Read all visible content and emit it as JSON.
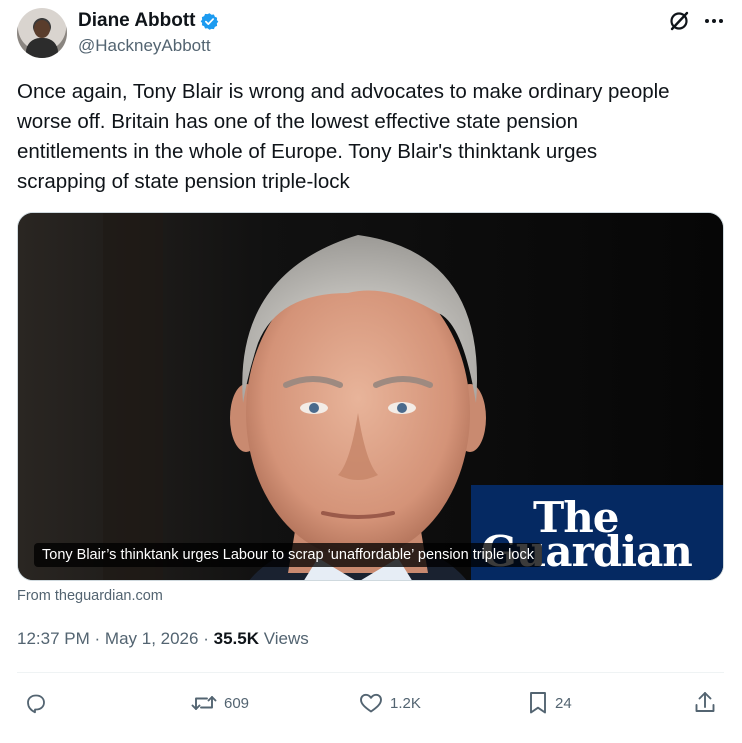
{
  "author": {
    "display_name": "Diane Abbott",
    "handle": "@HackneyAbbott",
    "verified": true
  },
  "tweet": {
    "text_lines": [
      "Once again, Tony Blair is wrong and advocates to make ordinary people",
      "worse off. Britain has one of the lowest effective state pension",
      "entitlements in the whole of Europe. Tony Blair's thinktank urges",
      "scrapping of state pension triple-lock"
    ]
  },
  "link_card": {
    "caption": "Tony Blair’s thinktank urges Labour to scrap ‘unaffordable’ pension triple lock",
    "brand_line1": "The",
    "brand_line2": "Guardian",
    "brand_color": "#052962",
    "source": "From theguardian.com"
  },
  "meta": {
    "time": "12:37 PM",
    "separator": "·",
    "date": "May 1, 2026",
    "views_count": "35.5K",
    "views_label": "Views"
  },
  "actions": {
    "reply_icon": "reply-icon",
    "retweet_count": "609",
    "like_count": "1.2K",
    "bookmark_count": "24",
    "share_icon": "share-icon"
  },
  "colors": {
    "text_primary": "#0f1419",
    "text_secondary": "#536471",
    "verified_blue": "#1d9bf0"
  }
}
